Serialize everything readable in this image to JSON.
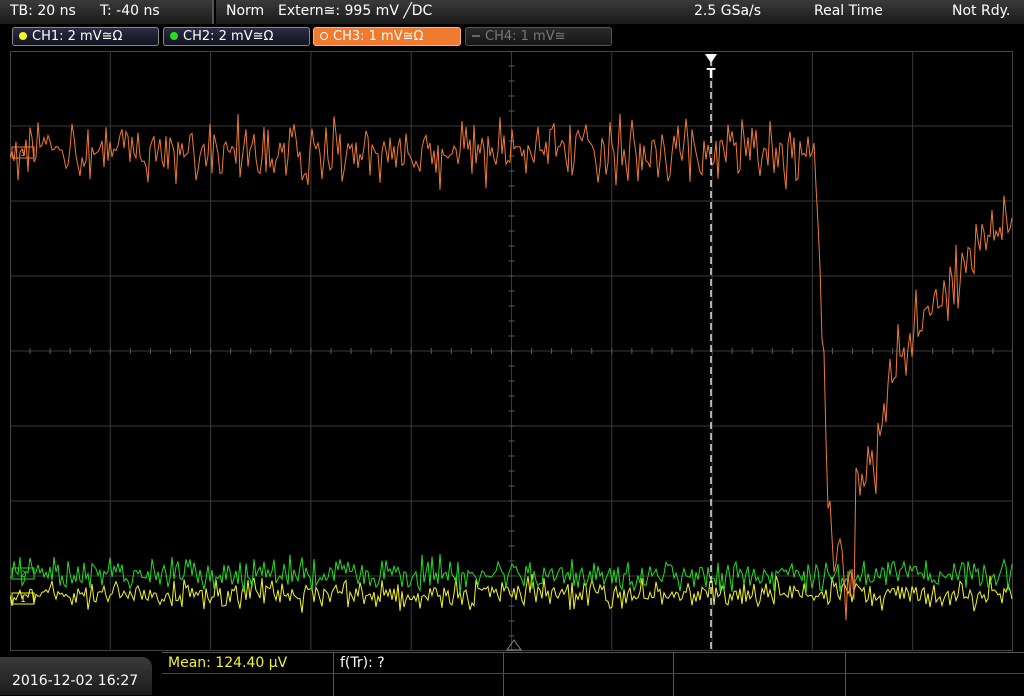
{
  "status": {
    "timebase": "TB: 20 ns",
    "trigger_offset": "T: -40 ns",
    "mode": "Norm",
    "trigger_source": "Extern≅: 995 mV ╱DC",
    "sample_rate": "2.5 GSa/s",
    "acq_mode": "Real Time",
    "state": "Not Rdy."
  },
  "channels": [
    {
      "label": "CH1: 2 mV≅Ω",
      "color": "#f4f422",
      "active": false,
      "enabled": true
    },
    {
      "label": "CH2: 2 mV≅Ω",
      "color": "#22dd22",
      "active": false,
      "enabled": true
    },
    {
      "label": "CH3: 1 mV≅Ω",
      "color": "#f07a30",
      "active": true,
      "enabled": true
    },
    {
      "label": "CH4: 1 mV≅",
      "color": "#666666",
      "active": false,
      "enabled": false
    }
  ],
  "trigger_marker": "T",
  "channel_markers": {
    "ch3": "3",
    "ch2": "2",
    "ch1": "1"
  },
  "datetime": "2016-12-02 16:27",
  "measurements": {
    "mean": "Mean: 124.40 µV",
    "rise": "f(Tr): ?"
  },
  "colors": {
    "grid": "#3a3a3a",
    "grid_center": "#5a5a5a",
    "ch1": "#f4f422",
    "ch2": "#22dd22",
    "ch3": "#f07a30"
  }
}
